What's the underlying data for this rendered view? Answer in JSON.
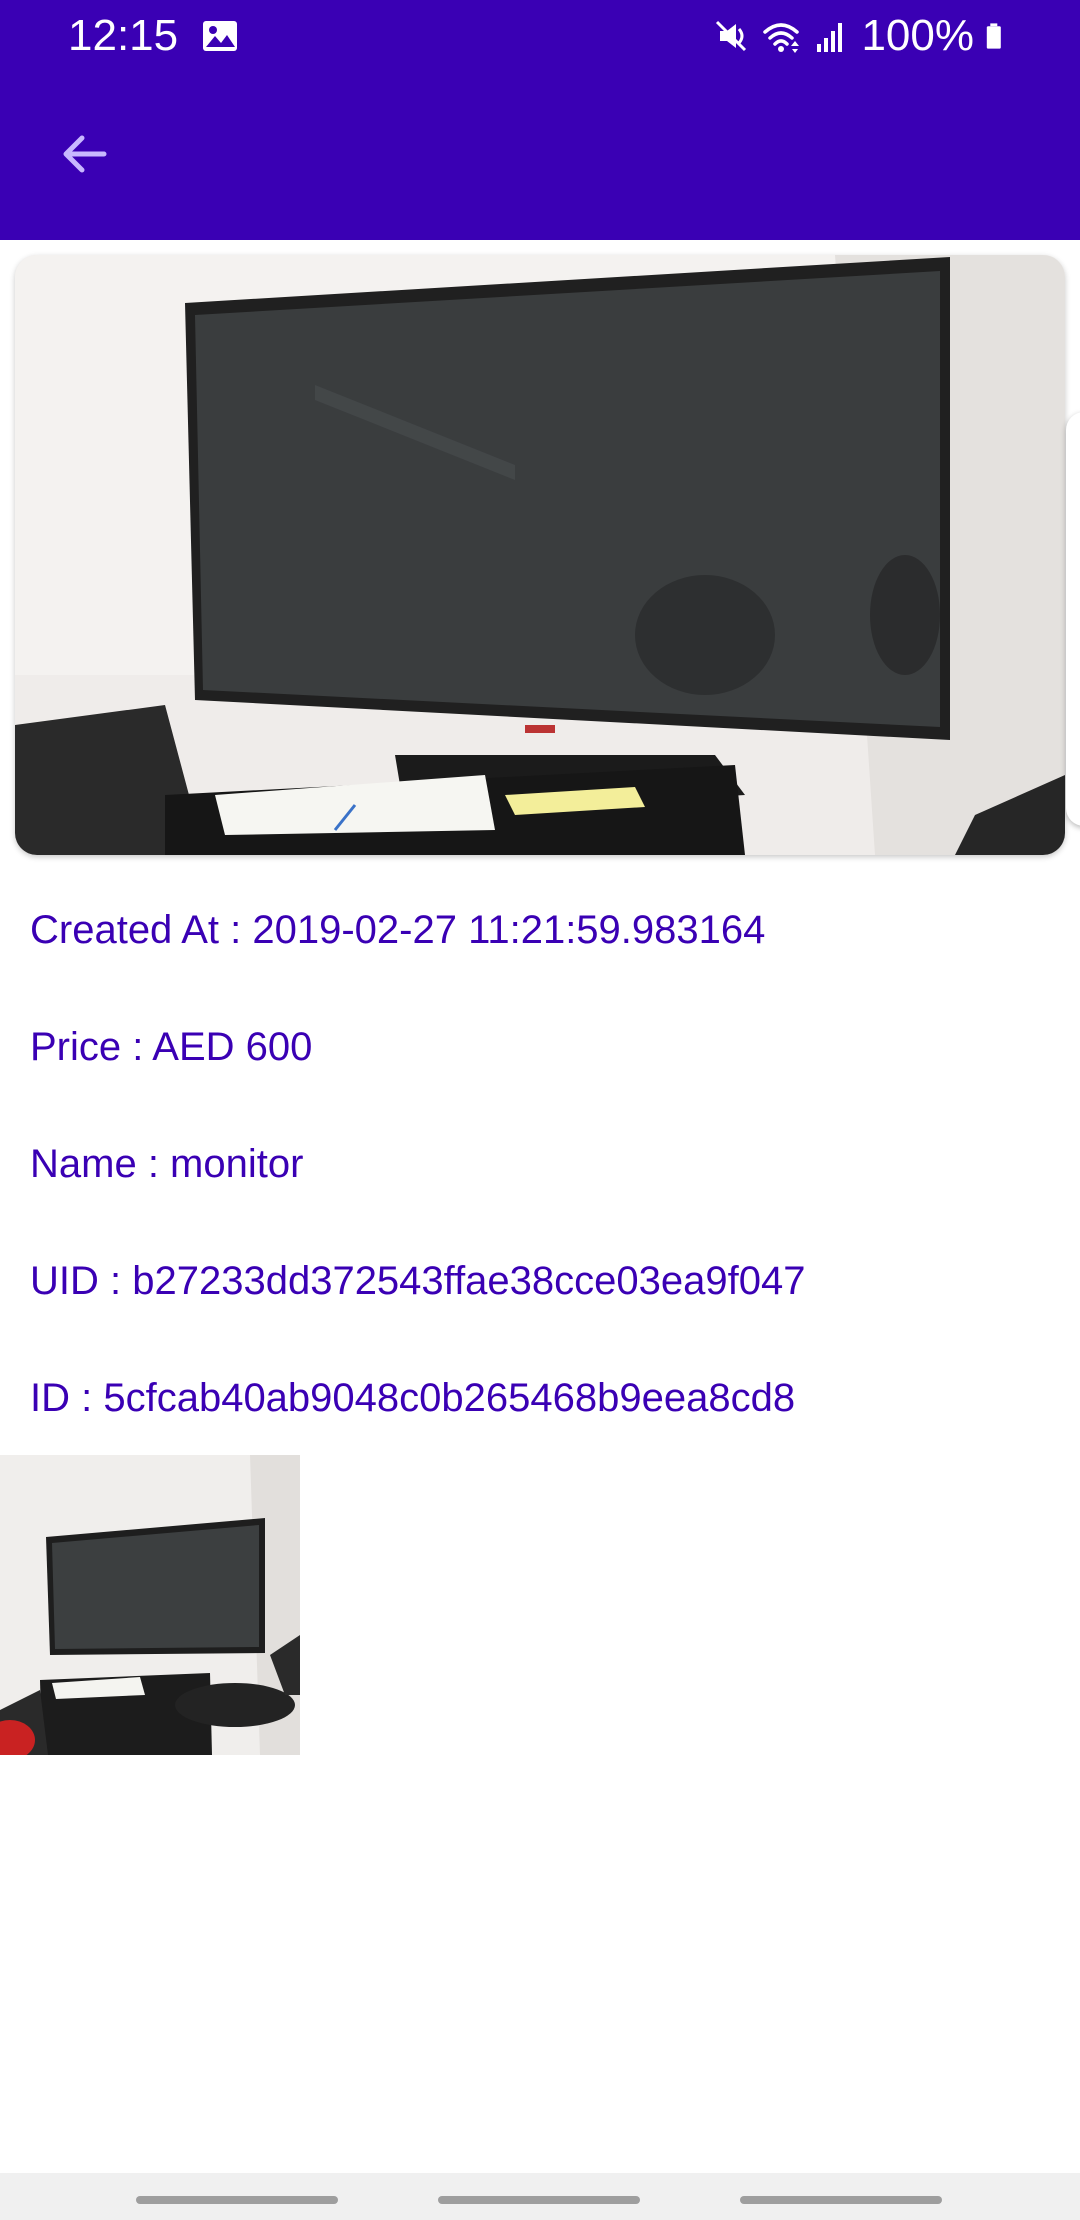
{
  "status_bar": {
    "time": "12:15",
    "battery": "100%",
    "icons": [
      "gallery-icon",
      "mute-icon",
      "wifi-icon",
      "signal-icon",
      "battery-icon"
    ]
  },
  "toolbar": {
    "back_icon": "arrow-back-icon"
  },
  "details": {
    "created_at": "Created At : 2019-02-27 11:21:59.983164",
    "price": "Price : AED 600",
    "name": "Name : monitor",
    "uid": "UID : b27233dd372543ffae38cce03ea9f047",
    "id": "ID : 5cfcab40ab9048c0b265468b9eea8cd8"
  },
  "colors": {
    "primary": "#3a00b4",
    "text": "#3a00b4",
    "background": "#ffffff"
  }
}
